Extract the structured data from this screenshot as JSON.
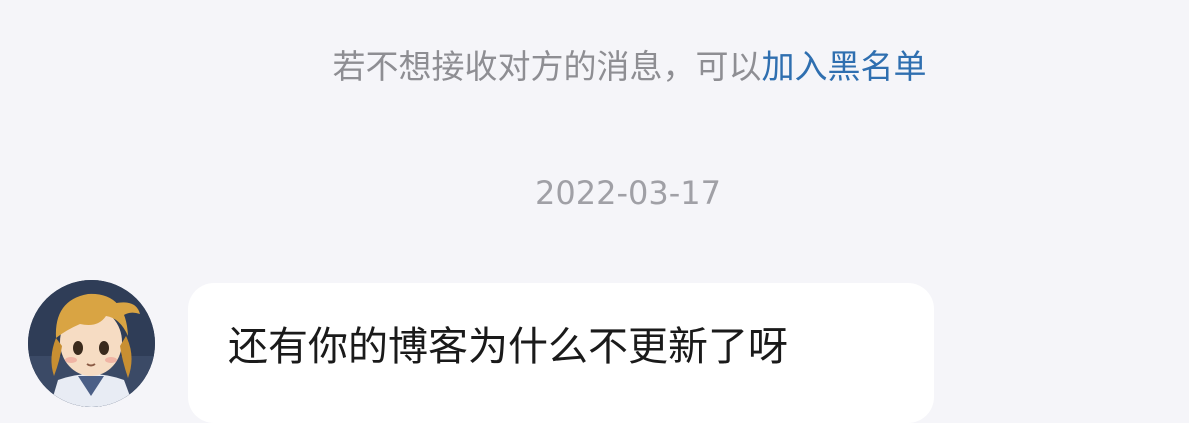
{
  "chat": {
    "blacklist_notice": {
      "prefix": "若不想接收对方的消息，可以",
      "link_label": "加入黑名单",
      "link_color": "#2f6fb0"
    },
    "timestamp": "2022-03-17",
    "messages": [
      {
        "sender": "other",
        "avatar_icon": "anime-girl-avatar",
        "text": "还有你的博客为什么不更新了呀"
      }
    ]
  }
}
